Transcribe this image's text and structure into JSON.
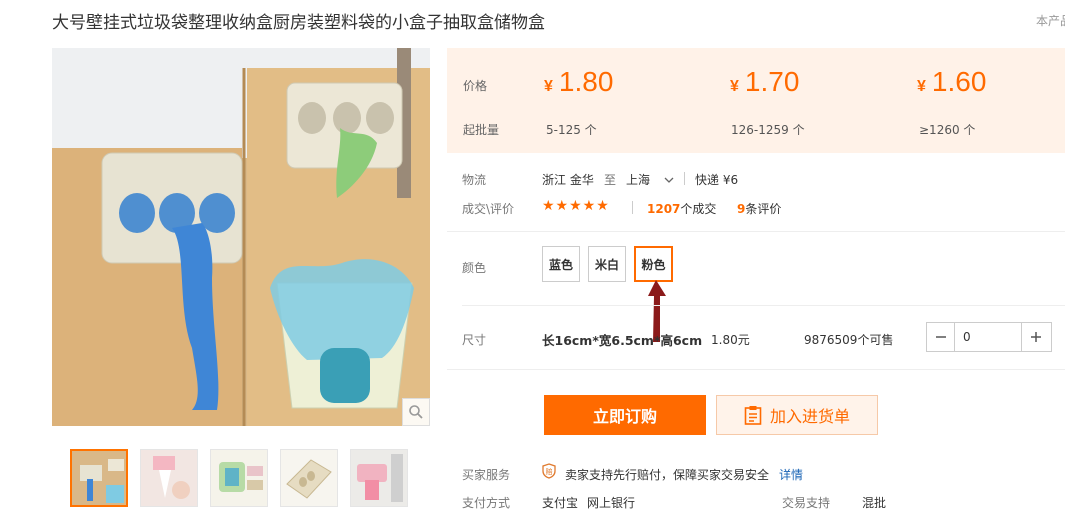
{
  "product": {
    "title": "大号壁挂式垃圾袋整理收纳盒厨房装塑料袋的小盒子抽取盒储物盒",
    "corner_note": "本产品"
  },
  "price_panel": {
    "price_label": "价格",
    "moq_label": "起批量",
    "currency": "¥",
    "tiers": [
      {
        "price": "1.80",
        "range": "5-125 个"
      },
      {
        "price": "1.70",
        "range": "126-1259 个"
      },
      {
        "price": "1.60",
        "range": "≥1260 个"
      }
    ]
  },
  "logistics": {
    "label": "物流",
    "origin": "浙江 金华",
    "to": "至",
    "destination": "上海",
    "shipping": "快递 ¥6"
  },
  "reviews": {
    "label": "成交\\评价",
    "stars": "★★★★★",
    "deals_count": "1207",
    "deals_suffix": "个成交",
    "review_count": "9",
    "review_suffix": "条评价"
  },
  "color": {
    "label": "颜色",
    "options": [
      "蓝色",
      "米白",
      "粉色"
    ],
    "selected": "粉色"
  },
  "size": {
    "label": "尺寸",
    "value": "长16cm*宽6.5cm*高6cm",
    "price": "1.80元",
    "stock": "9876509个可售",
    "quantity": "0"
  },
  "actions": {
    "buy": "立即订购",
    "cart": "加入进货单"
  },
  "service": {
    "label": "买家服务",
    "text": "卖家支持先行赔付，保障买家交易安全",
    "detail_link": "详情"
  },
  "payment": {
    "label": "支付方式",
    "methods": [
      "支付宝",
      "网上银行"
    ],
    "trade_label": "交易支持",
    "trade_value": "混批"
  },
  "colors": {
    "accent": "#ff6a00",
    "price_bg": "#fff2e8",
    "annotation_arrow": "#8b1a1a"
  }
}
